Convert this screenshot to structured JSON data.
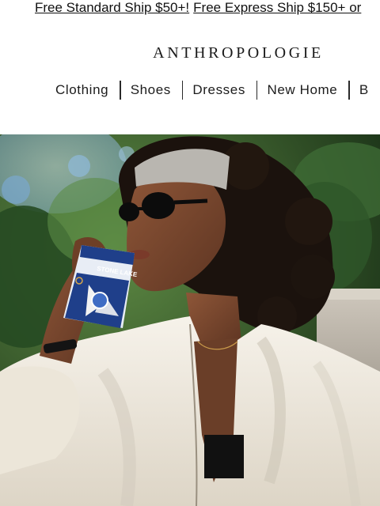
{
  "promo": {
    "standard_ship": "Free Standard Ship $50+!",
    "express_ship": "Free Express Ship $150+ or"
  },
  "header": {
    "logo_text": "ANTHROPOLOGIE"
  },
  "nav": {
    "items": [
      {
        "label": "Clothing"
      },
      {
        "label": "Shoes"
      },
      {
        "label": "Dresses"
      },
      {
        "label": "New Home"
      },
      {
        "label": "B"
      }
    ]
  },
  "hero": {
    "cup_text": "STONE LAKE",
    "colors": {
      "foliage_dark": "#1f3a1c",
      "foliage_light": "#4f7a3c",
      "sky": "#9cc3e0",
      "skin": "#7a4a30",
      "hair": "#1c120d",
      "headband": "#b9b6b0",
      "blouse": "#efe9dd",
      "cup_blue": "#1f3f8a"
    }
  }
}
